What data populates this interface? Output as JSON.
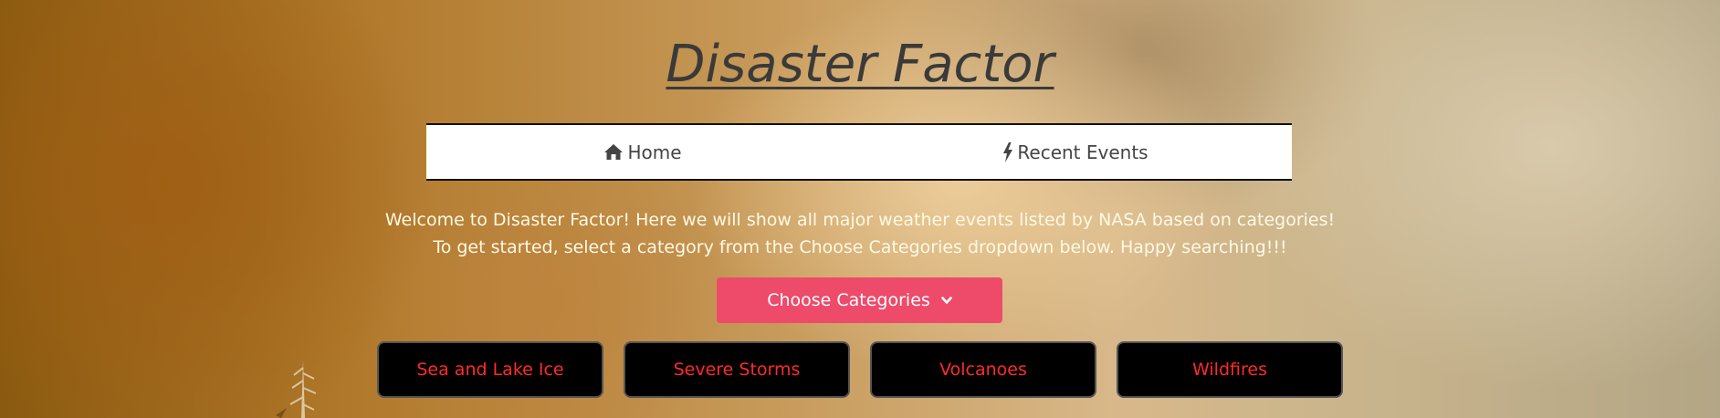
{
  "header": {
    "title": "Disaster Factor"
  },
  "nav": {
    "items": [
      {
        "label": "Home",
        "icon": "home-icon"
      },
      {
        "label": "Recent Events",
        "icon": "bolt-icon"
      }
    ]
  },
  "welcome": {
    "line1": "Welcome to Disaster Factor! Here we will show all major weather events listed by NASA based on categories!",
    "line2": "To get started, select a category from the Choose Categories dropdown below. Happy searching!!!"
  },
  "dropdown": {
    "label": "Choose Categories",
    "icon": "chevron-down-icon",
    "color": "#ee4a6a"
  },
  "categories": [
    {
      "label": "Sea and Lake Ice"
    },
    {
      "label": "Severe Storms"
    },
    {
      "label": "Volcanoes"
    },
    {
      "label": "Wildfires"
    }
  ],
  "colors": {
    "category_text": "#ff2a2a",
    "category_bg": "#000000",
    "title": "#3a3a3a"
  }
}
